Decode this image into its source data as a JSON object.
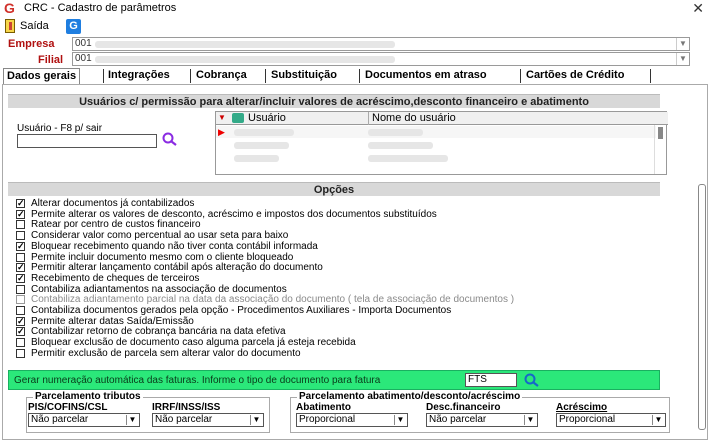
{
  "window": {
    "title": "CRC - Cadastro de parâmetros",
    "close_glyph": "✕"
  },
  "toolbar": {
    "exit_label": "Saída",
    "g_badge": "G"
  },
  "fields": {
    "empresa_label": "Empresa",
    "empresa_value": "001",
    "filial_label": "Filial",
    "filial_value": "001"
  },
  "tabs": [
    "Dados gerais",
    "Integrações",
    "Cobrança",
    "Substituição",
    "Documentos em atraso",
    "Cartões de Crédito"
  ],
  "users_section": {
    "header": "Usuários c/ permissão para alterar/incluir valores de acréscimo,desconto financeiro e abatimento",
    "user_label": "Usuário - F8 p/ sair",
    "user_value": "",
    "grid_col_user": "Usuário",
    "grid_col_name": "Nome do usuário"
  },
  "options_section": {
    "header": "Opções",
    "items": [
      {
        "label": "Alterar documentos já contabilizados",
        "checked": "✓",
        "enabled": true
      },
      {
        "label": "Permite alterar os valores de desconto, acréscimo  e impostos dos documentos substituídos",
        "checked": "✓",
        "enabled": true
      },
      {
        "label": "Ratear por centro de custos financeiro",
        "checked": "",
        "enabled": true
      },
      {
        "label": "Considerar valor como percentual ao usar seta para baixo",
        "checked": "",
        "enabled": true
      },
      {
        "label": "Bloquear recebimento quando não tiver conta contábil informada",
        "checked": "✓",
        "enabled": true
      },
      {
        "label": "Permite incluir documento mesmo com o cliente bloqueado",
        "checked": "",
        "enabled": true
      },
      {
        "label": "Permitir alterar lançamento contábil após alteração do documento",
        "checked": "✓",
        "enabled": true
      },
      {
        "label": "Recebimento de cheques de terceiros",
        "checked": "✓",
        "enabled": true
      },
      {
        "label": "Contabiliza adiantamentos na associação de documentos",
        "checked": "",
        "enabled": true
      },
      {
        "label": "Contabiliza adiantamento parcial na data da associação do documento ( tela de associação de documentos )",
        "checked": "",
        "enabled": false
      },
      {
        "label": "Contabiliza documentos gerados pela opção - Procedimentos Auxiliares - Importa Documentos",
        "checked": "",
        "enabled": true
      },
      {
        "label": "Permite alterar datas Saída/Emissão",
        "checked": "✓",
        "enabled": true
      },
      {
        "label": "Contabilizar retorno de cobrança bancária na data efetiva",
        "checked": "✓",
        "enabled": true
      },
      {
        "label": "Bloquear exclusão de documento caso alguma parcela já esteja recebida",
        "checked": "",
        "enabled": true
      },
      {
        "label": "Permitir exclusão de parcela sem alterar valor do documento",
        "checked": "",
        "enabled": true
      }
    ]
  },
  "invoice_numbering": {
    "text": "Gerar numeração automática das faturas. Informe o tipo de documento para fatura",
    "doc_type": "FTS"
  },
  "parcelamento_tributos": {
    "title": "Parcelamento tributos",
    "pis_label": "PIS/COFINS/CSL",
    "pis_value": "Não parcelar",
    "irrf_label": "IRRF/INSS/ISS",
    "irrf_value": "Não parcelar"
  },
  "parcelamento_abatimento": {
    "title": "Parcelamento abatimento/desconto/acréscimo",
    "abatimento_label": "Abatimento",
    "abatimento_value": "Proporcional",
    "desc_label": "Desc.financeiro",
    "desc_value": "Não parcelar",
    "acrescimo_label": "Acréscimo",
    "acrescimo_value": "Proporcional"
  },
  "colors": {
    "green_bar": "#2be87a",
    "label_red": "#b01010",
    "section_bg": "#d8d8d8"
  }
}
